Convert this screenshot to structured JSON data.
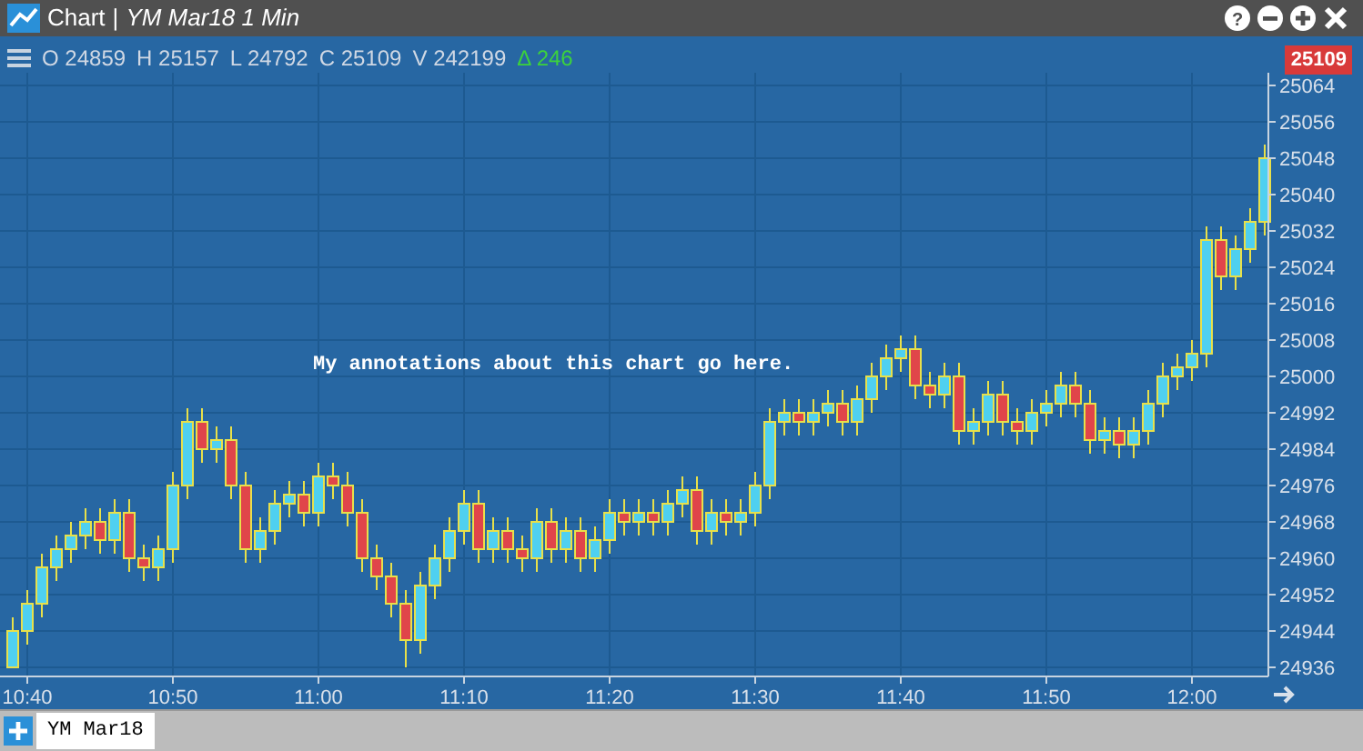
{
  "window": {
    "title": "Chart",
    "separator": "|",
    "subtitle": "YM Mar18 1 Min",
    "help_glyph": "?"
  },
  "legend": {
    "items": [
      {
        "label": "O",
        "value": "24859"
      },
      {
        "label": "H",
        "value": "25157"
      },
      {
        "label": "L",
        "value": "24792"
      },
      {
        "label": "C",
        "value": "25109"
      },
      {
        "label": "V",
        "value": "242199"
      }
    ],
    "change_symbol": "Δ",
    "change": "246"
  },
  "last_price": "25109",
  "annotation": "My annotations about this chart go here.",
  "chart_data": {
    "type": "candlestick",
    "grid": true,
    "categories": [
      null,
      "10:40",
      null,
      null,
      null,
      null,
      null,
      null,
      null,
      null,
      null,
      "10:50",
      null,
      null,
      null,
      null,
      null,
      null,
      null,
      null,
      null,
      "11:00",
      null,
      null,
      null,
      null,
      null,
      null,
      null,
      null,
      null,
      "11:10",
      null,
      null,
      null,
      null,
      null,
      null,
      null,
      null,
      null,
      "11:20",
      null,
      null,
      null,
      null,
      null,
      null,
      null,
      null,
      null,
      "11:30",
      null,
      null,
      null,
      null,
      null,
      null,
      null,
      null,
      null,
      "11:40",
      null,
      null,
      null,
      null,
      null,
      null,
      null,
      null,
      null,
      "11:50",
      null,
      null,
      null,
      null,
      null,
      null,
      null,
      null,
      null,
      "12:00",
      null,
      null,
      null,
      null,
      null
    ],
    "yticks": [
      24936,
      24944,
      24952,
      24960,
      24968,
      24976,
      24984,
      24992,
      25000,
      25008,
      25016,
      25024,
      25032,
      25040,
      25048,
      25056,
      25064
    ],
    "ylim": [
      24936,
      25064
    ],
    "ohlc": [
      [
        24936,
        24947,
        24936,
        24944
      ],
      [
        24944,
        24953,
        24941,
        24950
      ],
      [
        24950,
        24961,
        24947,
        24958
      ],
      [
        24958,
        24965,
        24955,
        24962
      ],
      [
        24962,
        24968,
        24959,
        24965
      ],
      [
        24965,
        24971,
        24962,
        24968
      ],
      [
        24968,
        24971,
        24961,
        24964
      ],
      [
        24964,
        24973,
        24961,
        24970
      ],
      [
        24970,
        24973,
        24957,
        24960
      ],
      [
        24960,
        24963,
        24955,
        24958
      ],
      [
        24958,
        24965,
        24955,
        24962
      ],
      [
        24962,
        24979,
        24959,
        24976
      ],
      [
        24976,
        24993,
        24973,
        24990
      ],
      [
        24990,
        24993,
        24981,
        24984
      ],
      [
        24984,
        24989,
        24981,
        24986
      ],
      [
        24986,
        24989,
        24973,
        24976
      ],
      [
        24976,
        24979,
        24959,
        24962
      ],
      [
        24962,
        24969,
        24959,
        24966
      ],
      [
        24966,
        24975,
        24963,
        24972
      ],
      [
        24972,
        24977,
        24969,
        24974
      ],
      [
        24974,
        24977,
        24967,
        24970
      ],
      [
        24970,
        24981,
        24967,
        24978
      ],
      [
        24978,
        24981,
        24973,
        24976
      ],
      [
        24976,
        24979,
        24967,
        24970
      ],
      [
        24970,
        24973,
        24957,
        24960
      ],
      [
        24960,
        24963,
        24953,
        24956
      ],
      [
        24956,
        24959,
        24947,
        24950
      ],
      [
        24950,
        24953,
        24936,
        24942
      ],
      [
        24942,
        24957,
        24939,
        24954
      ],
      [
        24954,
        24963,
        24951,
        24960
      ],
      [
        24960,
        24969,
        24957,
        24966
      ],
      [
        24966,
        24975,
        24963,
        24972
      ],
      [
        24972,
        24975,
        24959,
        24962
      ],
      [
        24962,
        24969,
        24959,
        24966
      ],
      [
        24966,
        24969,
        24959,
        24962
      ],
      [
        24962,
        24965,
        24957,
        24960
      ],
      [
        24960,
        24971,
        24957,
        24968
      ],
      [
        24968,
        24971,
        24959,
        24962
      ],
      [
        24962,
        24969,
        24959,
        24966
      ],
      [
        24966,
        24969,
        24957,
        24960
      ],
      [
        24960,
        24967,
        24957,
        24964
      ],
      [
        24964,
        24973,
        24961,
        24970
      ],
      [
        24970,
        24973,
        24965,
        24968
      ],
      [
        24968,
        24973,
        24965,
        24970
      ],
      [
        24970,
        24973,
        24965,
        24968
      ],
      [
        24968,
        24975,
        24965,
        24972
      ],
      [
        24972,
        24978,
        24969,
        24975
      ],
      [
        24975,
        24978,
        24963,
        24966
      ],
      [
        24966,
        24973,
        24963,
        24970
      ],
      [
        24970,
        24973,
        24965,
        24968
      ],
      [
        24968,
        24973,
        24965,
        24970
      ],
      [
        24970,
        24979,
        24967,
        24976
      ],
      [
        24976,
        24993,
        24973,
        24990
      ],
      [
        24990,
        24995,
        24987,
        24992
      ],
      [
        24992,
        24995,
        24987,
        24990
      ],
      [
        24990,
        24995,
        24987,
        24992
      ],
      [
        24992,
        24997,
        24989,
        24994
      ],
      [
        24994,
        24997,
        24987,
        24990
      ],
      [
        24990,
        24998,
        24987,
        24995
      ],
      [
        24995,
        25003,
        24992,
        25000
      ],
      [
        25000,
        25007,
        24997,
        25004
      ],
      [
        25004,
        25009,
        25001,
        25006
      ],
      [
        25006,
        25009,
        24995,
        24998
      ],
      [
        24998,
        25001,
        24993,
        24996
      ],
      [
        24996,
        25003,
        24993,
        25000
      ],
      [
        25000,
        25003,
        24985,
        24988
      ],
      [
        24988,
        24993,
        24985,
        24990
      ],
      [
        24990,
        24999,
        24987,
        24996
      ],
      [
        24996,
        24999,
        24987,
        24990
      ],
      [
        24990,
        24993,
        24985,
        24988
      ],
      [
        24988,
        24995,
        24985,
        24992
      ],
      [
        24992,
        24997,
        24989,
        24994
      ],
      [
        24994,
        25001,
        24991,
        24998
      ],
      [
        24998,
        25001,
        24991,
        24994
      ],
      [
        24994,
        24997,
        24983,
        24986
      ],
      [
        24986,
        24991,
        24983,
        24988
      ],
      [
        24988,
        24991,
        24982,
        24985
      ],
      [
        24985,
        24991,
        24982,
        24988
      ],
      [
        24988,
        24997,
        24985,
        24994
      ],
      [
        24994,
        25003,
        24991,
        25000
      ],
      [
        25000,
        25005,
        24997,
        25002
      ],
      [
        25002,
        25008,
        24999,
        25005
      ],
      [
        25005,
        25033,
        25002,
        25030
      ],
      [
        25030,
        25033,
        25019,
        25022
      ],
      [
        25022,
        25031,
        25019,
        25028
      ],
      [
        25028,
        25037,
        25025,
        25034
      ],
      [
        25034,
        25051,
        25031,
        25048
      ]
    ]
  },
  "tabs": [
    {
      "label": "YM Mar18",
      "selected": true
    }
  ]
}
